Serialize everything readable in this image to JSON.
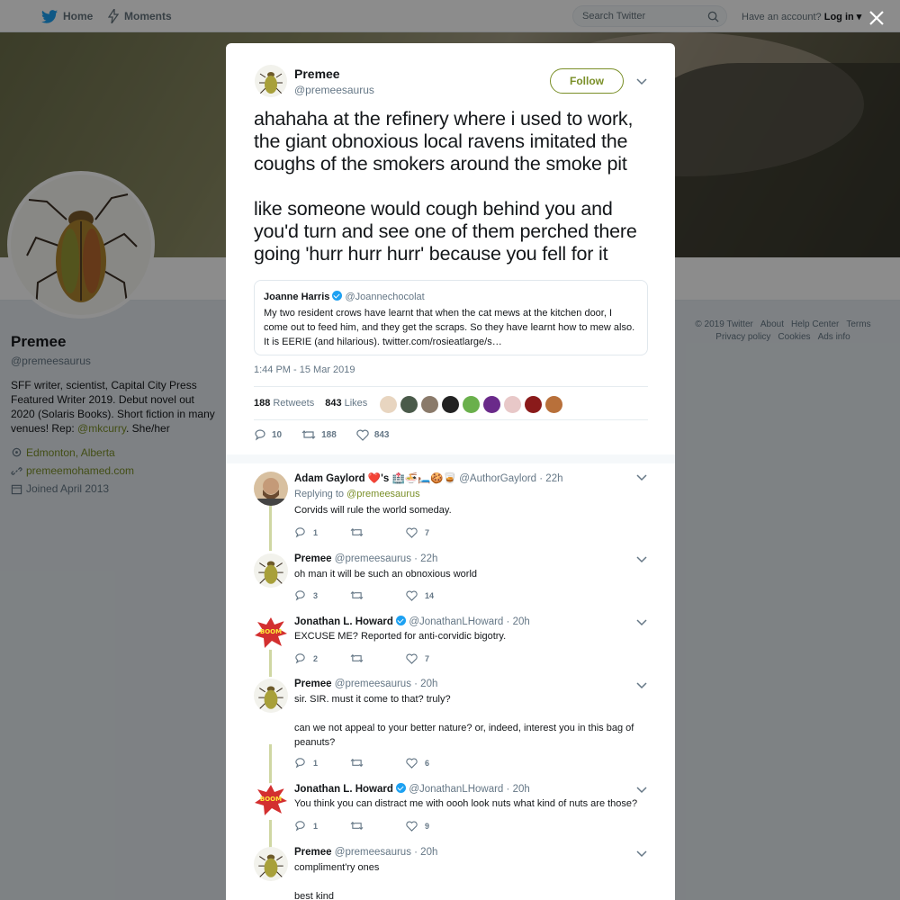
{
  "nav": {
    "home": "Home",
    "moments": "Moments",
    "search_placeholder": "Search Twitter",
    "have_account": "Have an account?",
    "login": "Log in"
  },
  "profile": {
    "name": "Premee",
    "handle": "@premeesaurus",
    "bio_main": "SFF writer, scientist, Capital City Press Featured Writer 2019. Debut novel out 2020 (Solaris Books). Short fiction in many venues! Rep: ",
    "bio_rep": "@mkcurry",
    "bio_end": ". She/her",
    "location": "Edmonton, Alberta",
    "website": "premeemohamed.com",
    "joined": "Joined April 2013"
  },
  "footer": {
    "copyright": "© 2019 Twitter",
    "about": "About",
    "help": "Help Center",
    "terms": "Terms",
    "privacy": "Privacy policy",
    "cookies": "Cookies",
    "ads": "Ads info"
  },
  "tweet": {
    "name": "Premee",
    "handle": "@premeesaurus",
    "follow": "Follow",
    "text": "ahahaha at the refinery where i used to work, the giant obnoxious local ravens imitated the coughs of the smokers around the smoke pit\n\nlike someone would cough behind you and you'd turn and see one of them perched there going 'hurr hurr hurr' because you fell for it",
    "quote": {
      "name": "Joanne Harris",
      "handle": "@Joannechocolat",
      "body": "My two resident crows have learnt that when the cat mews at the kitchen door, I come out to feed him, and they get the scraps. So they have learnt how to mew also. It is EERIE (and hilarious). twitter.com/rosieatlarge/s…"
    },
    "timestamp": "1:44 PM - 15 Mar 2019",
    "retweets": "188",
    "retweets_label": "Retweets",
    "likes": "843",
    "likes_label": "Likes",
    "reply_count": "10",
    "retweet_count": "188",
    "like_count": "843"
  },
  "replies": [
    {
      "name": "Adam Gaylord ❤️'s 🏥🍜🛏️🍪🥃",
      "handle": "@AuthorGaylord",
      "time": "· 22h",
      "replying_prefix": "Replying to ",
      "replying_to": "@premeesaurus",
      "body": "Corvids will rule the world someday.",
      "replies": "1",
      "retweets": "",
      "likes": "7"
    },
    {
      "name": "Premee",
      "handle": "@premeesaurus",
      "time": "· 22h",
      "body": "oh man it will be such an obnoxious world",
      "replies": "3",
      "retweets": "",
      "likes": "14"
    },
    {
      "name": "Jonathan L. Howard",
      "handle": "@JonathanLHoward",
      "time": "· 20h",
      "body": "EXCUSE ME? Reported for anti-corvidic bigotry.",
      "replies": "2",
      "retweets": "",
      "likes": "7"
    },
    {
      "name": "Premee",
      "handle": "@premeesaurus",
      "time": "· 20h",
      "body": "sir. SIR. must it come to that? truly?\n\ncan we not appeal to your better nature? or, indeed, interest you in this bag of peanuts?",
      "replies": "1",
      "retweets": "",
      "likes": "6"
    },
    {
      "name": "Jonathan L. Howard",
      "handle": "@JonathanLHoward",
      "time": "· 20h",
      "body": "You think you can distract me with oooh look nuts what kind of nuts are those?",
      "replies": "1",
      "retweets": "",
      "likes": "9"
    },
    {
      "name": "Premee",
      "handle": "@premeesaurus",
      "time": "· 20h",
      "body": "compliment'ry ones\n\nbest kind",
      "replies": "",
      "retweets": "",
      "likes": ""
    }
  ],
  "colors": {
    "accent": "#7a8f28",
    "verified": "#1da1f2",
    "text": "#14171a",
    "muted": "#657786"
  },
  "icons": [
    "twitter-bird-icon",
    "lightning-icon",
    "search-icon",
    "close-icon",
    "chevron-down-icon",
    "location-icon",
    "link-icon",
    "calendar-icon",
    "reply-icon",
    "retweet-icon",
    "heart-icon",
    "verified-icon"
  ]
}
